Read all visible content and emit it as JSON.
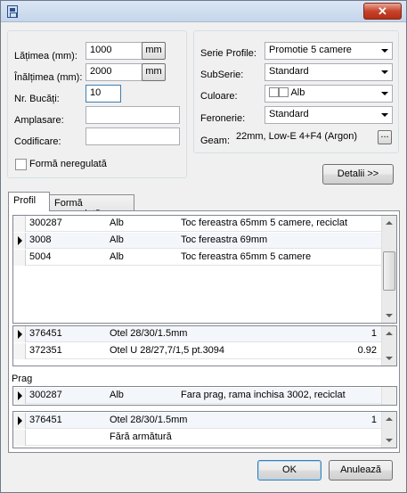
{
  "titlebar": {
    "close_label": "✕"
  },
  "dimensions": {
    "width_label": "Lățimea (mm):",
    "width_value": "1000",
    "width_unit": "mm",
    "height_label": "Înălțimea (mm):",
    "height_value": "2000",
    "height_unit": "mm",
    "count_label": "Nr. Bucăți:",
    "count_value": "10",
    "location_label": "Amplasare:",
    "location_value": "",
    "code_label": "Codificare:",
    "code_value": "",
    "irregular_label": "Formă neregulată"
  },
  "profile": {
    "series_label": "Serie Profile:",
    "series_value": "Promotie 5 camere",
    "subseries_label": "SubSerie:",
    "subseries_value": "Standard",
    "color_label": "Culoare:",
    "color_value": "Alb",
    "hardware_label": "Feronerie:",
    "hardware_value": "Standard",
    "glass_label": "Geam:",
    "glass_value": "22mm, Low-E 4+F4 (Argon)",
    "glass_button": "...",
    "details_button": "Detalii >>"
  },
  "tabs": [
    {
      "label": "Profil"
    },
    {
      "label": "Formă neregulată"
    }
  ],
  "profiles_grid": {
    "rows": [
      {
        "code": "300287",
        "color": "Alb",
        "desc": "Toc fereastra 65mm 5 camere, reciclat"
      },
      {
        "code": "3008",
        "color": "Alb",
        "desc": "Toc fereastra 69mm"
      },
      {
        "code": "5004",
        "color": "Alb",
        "desc": "Toc fereastra 65mm 5 camere"
      }
    ]
  },
  "reinforcement_grid": {
    "rows": [
      {
        "code": "376451",
        "desc": "Otel 28/30/1.5mm",
        "value": "1"
      },
      {
        "code": "372351",
        "desc": "Otel U 28/27,7/1,5 pt.3094",
        "value": "0.92"
      }
    ]
  },
  "threshold": {
    "label": "Prag",
    "row": {
      "code": "300287",
      "color": "Alb",
      "desc": "Fara prag, rama inchisa 3002, reciclat"
    }
  },
  "threshold_reinforcement": {
    "rows": [
      {
        "code": "376451",
        "desc": "Otel 28/30/1.5mm",
        "value": "1"
      },
      {
        "code": "",
        "desc": "Fără armătură",
        "value": ""
      }
    ]
  },
  "footer": {
    "ok_label": "OK",
    "cancel_label": "Anulează"
  }
}
